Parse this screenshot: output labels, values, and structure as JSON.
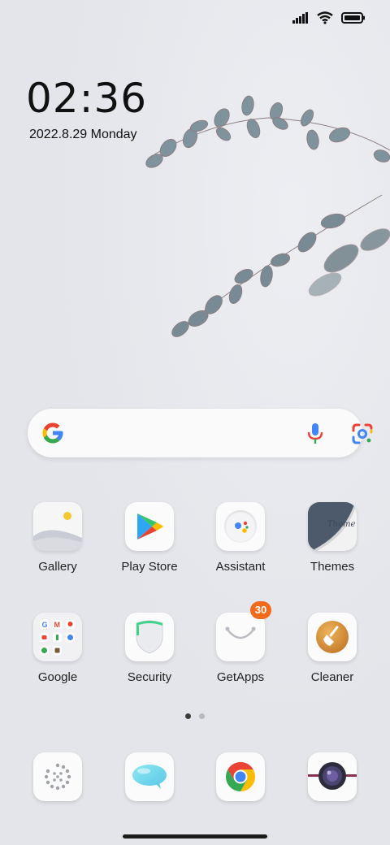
{
  "status": {
    "signal_icon": "signal-icon",
    "wifi_icon": "wifi-icon",
    "battery_icon": "battery-icon"
  },
  "clock": {
    "time": "02:36",
    "date": "2022.8.29 Monday"
  },
  "search": {
    "logo_icon": "google-g-icon",
    "mic_icon": "microphone-icon",
    "lens_icon": "google-lens-icon",
    "colors": {
      "blue": "#4285F4",
      "red": "#EA4335",
      "yellow": "#FBBC05",
      "green": "#34A853"
    }
  },
  "apps": {
    "row1": [
      {
        "label": "Gallery"
      },
      {
        "label": "Play Store"
      },
      {
        "label": "Assistant"
      },
      {
        "label": "Themes",
        "icon_text": "Theme"
      }
    ],
    "row2": [
      {
        "label": "Google"
      },
      {
        "label": "Security"
      },
      {
        "label": "GetApps",
        "badge": "30"
      },
      {
        "label": "Cleaner"
      }
    ],
    "dock": [
      {
        "icon": "phone-dialer-icon"
      },
      {
        "icon": "messaging-icon"
      },
      {
        "icon": "chrome-icon"
      },
      {
        "icon": "camera-icon"
      }
    ]
  },
  "pager": {
    "pages": 2,
    "current": 1
  },
  "colors": {
    "badge": "#f26a1b",
    "leaf": "#8fa0a8"
  }
}
